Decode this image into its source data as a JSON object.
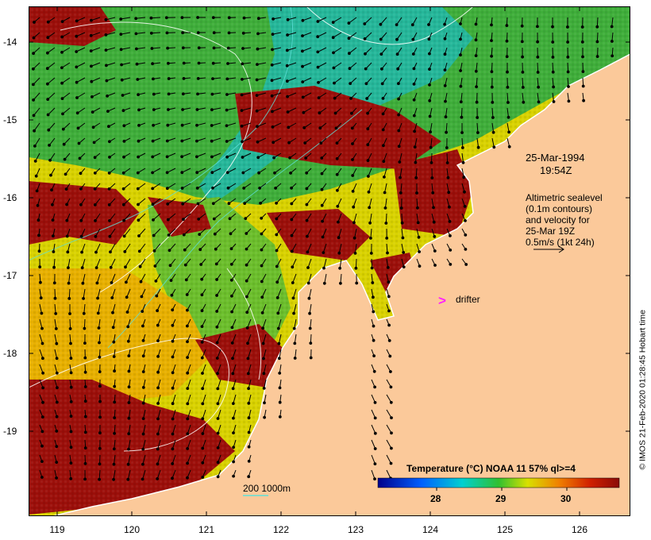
{
  "map": {
    "date": "25-Mar-1994",
    "time": "19:54Z",
    "altimetry_lines": [
      "Altimetric sealevel",
      "(0.1m contours)",
      "and velocity for",
      "25-Mar 19Z",
      "0.5m/s (1kt 24h)"
    ],
    "drifter_label": "drifter",
    "depth_label": "200  1000m",
    "colorbar": {
      "title": "Temperature (°C) NOAA 11 57% ql>=4",
      "ticks": [
        "28",
        "29",
        "30"
      ]
    },
    "credit": "© IMOS 21-Feb-2020 01:28:45 Hobart time",
    "y_ticks": [
      "-14",
      "-15",
      "-16",
      "-17",
      "-18",
      "-19"
    ],
    "x_ticks": [
      "119",
      "120",
      "121",
      "122",
      "123",
      "124",
      "125",
      "126"
    ],
    "colors": {
      "land": "#fbc99a",
      "hot": "#9c0f0a",
      "warm_yellow": "#e8d400",
      "green": "#1f9e3a",
      "teal": "#1fb9a2",
      "drifter": "#ff20ff",
      "arrow": "#000000"
    }
  }
}
